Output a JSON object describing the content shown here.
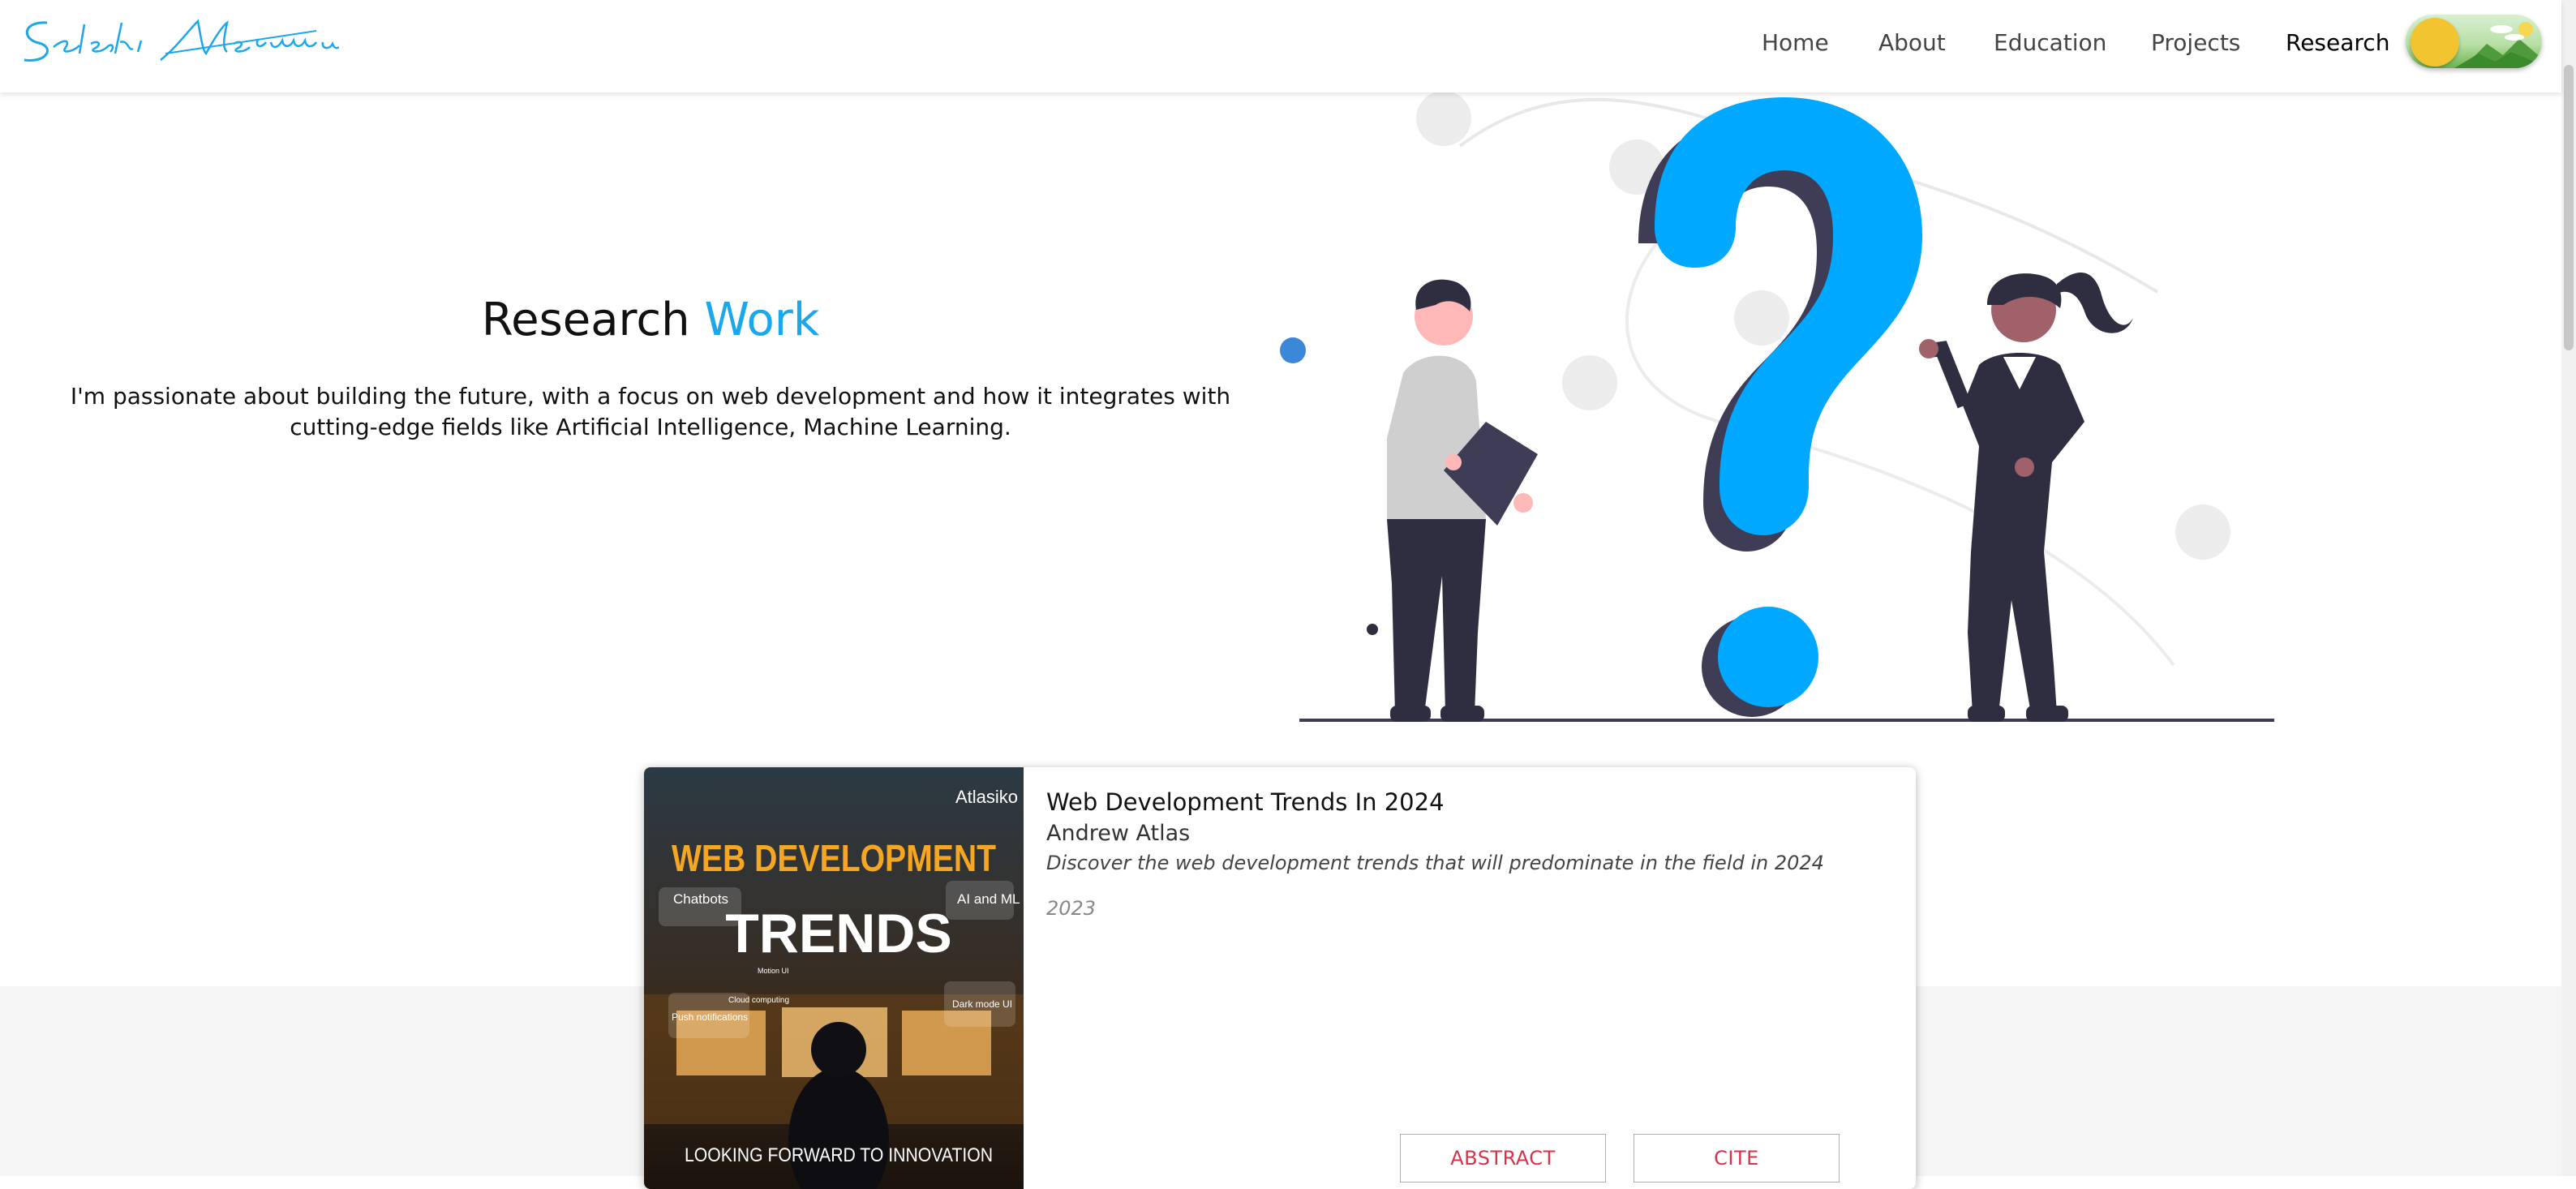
{
  "header": {
    "logo_text": "Seleshi Mefonnen",
    "nav": [
      "Home",
      "About",
      "Education",
      "Projects",
      "Research"
    ],
    "active_nav": "Research"
  },
  "hero": {
    "title_plain": "Research",
    "title_accent": "Work",
    "description": "I'm passionate about building the future, with a focus on web development and how it integrates with cutting-edge fields like Artificial Intelligence, Machine Learning."
  },
  "card": {
    "image": {
      "brand": "Atlasiko",
      "headline_1": "WEB DEVELOPMENT",
      "headline_2": "TRENDS",
      "tags": [
        "Chatbots",
        "AI and ML",
        "Push notifications",
        "Dark mode UI",
        "Cloud computing",
        "Motion UI"
      ],
      "footer": "LOOKING FORWARD TO INNOVATION"
    },
    "title": "Web Development Trends In 2024",
    "author": "Andrew Atlas",
    "description": "Discover the web development trends that will predominate in the field in 2024",
    "year": "2023",
    "abstract_label": "ABSTRACT",
    "cite_label": "CITE"
  },
  "colors": {
    "accent": "#1aa7ec",
    "button_text": "#d8334a"
  }
}
